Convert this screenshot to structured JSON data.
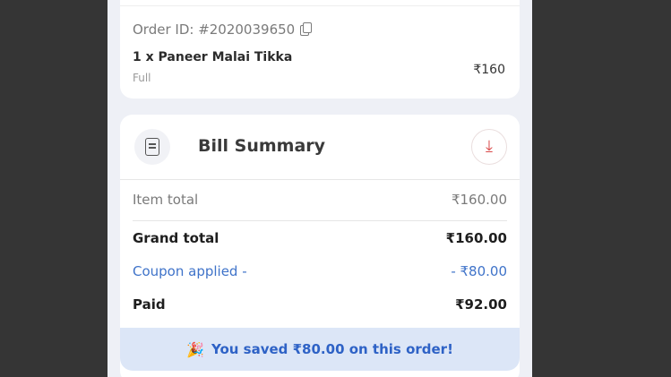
{
  "order": {
    "id_text": "Order ID: #2020039650",
    "item_name": "1 x Paneer Malai Tikka",
    "item_variant": "Full",
    "item_price": "₹160"
  },
  "bill": {
    "title": "Bill Summary",
    "item_total_label": "Item total",
    "item_total_value": "₹160.00",
    "grand_total_label": "Grand total",
    "grand_total_value": "₹160.00",
    "coupon_label": "Coupon applied -",
    "coupon_value": "- ₹80.00",
    "paid_label": "Paid",
    "paid_value": "₹92.00"
  },
  "savings": {
    "text": "You saved ₹80.00 on this order!",
    "icon": "party-popper-icon"
  },
  "colors": {
    "coupon": "#3f73c9",
    "savings_bg": "#dce6f7",
    "download_accent": "#d94a4a"
  }
}
